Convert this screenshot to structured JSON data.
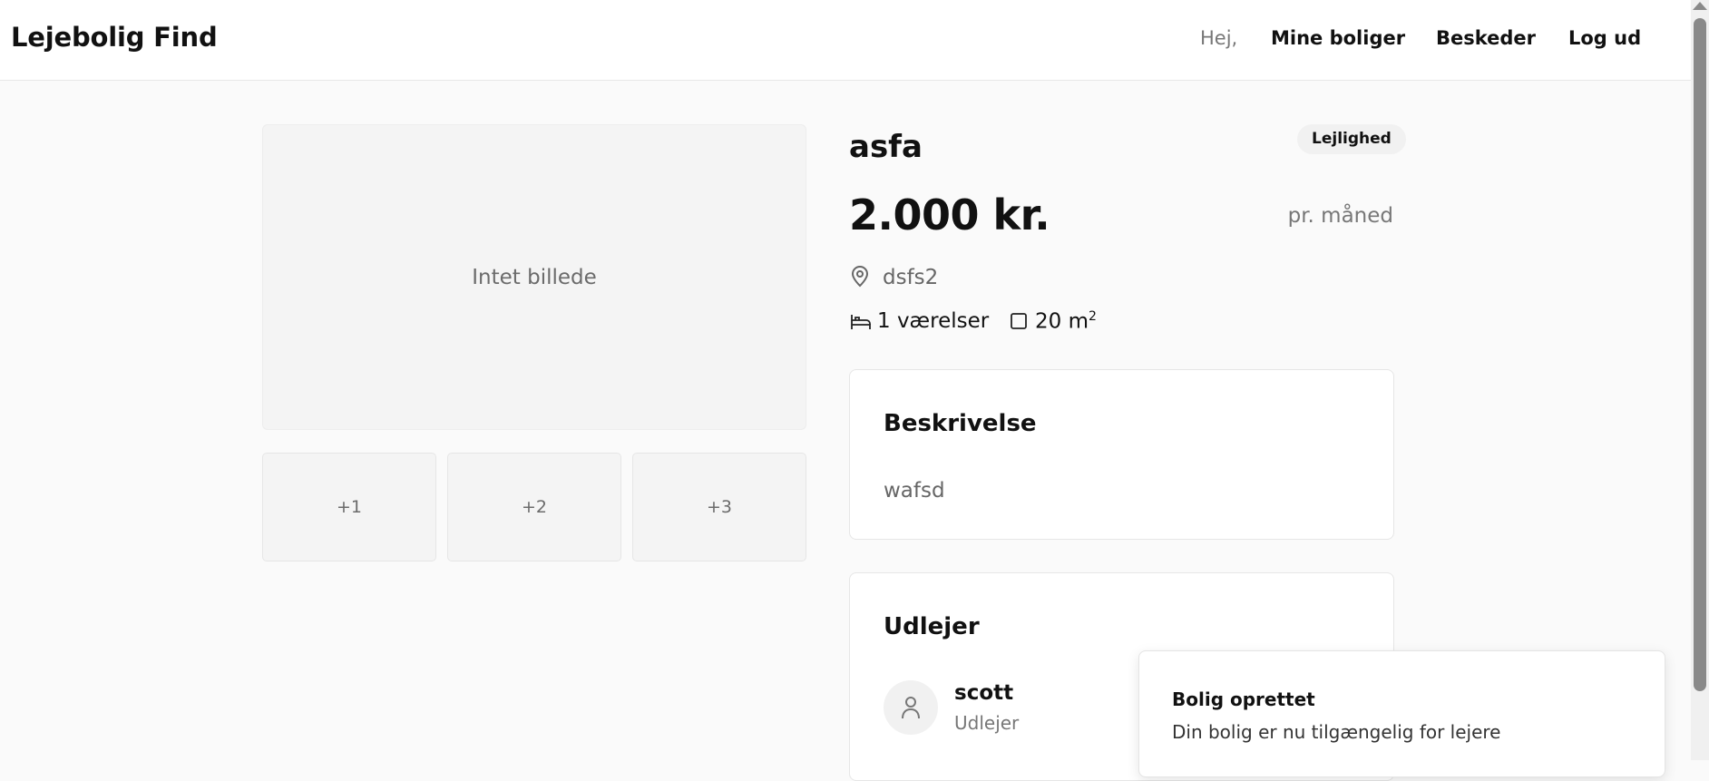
{
  "header": {
    "brand": "Lejebolig Find",
    "greeting": "Hej,",
    "nav": {
      "my_listings": "Mine boliger",
      "messages": "Beskeder",
      "logout": "Log ud"
    }
  },
  "gallery": {
    "main_placeholder": "Intet billede",
    "thumbnails": [
      "+1",
      "+2",
      "+3"
    ]
  },
  "listing": {
    "title": "asfa",
    "type_badge": "Lejlighed",
    "price": "2.000 kr.",
    "price_period": "pr. måned",
    "address": "dsfs2",
    "rooms": "1 værelser",
    "area_value": "20 m",
    "area_unit_sup": "2",
    "icons": {
      "address": "map-pin-icon",
      "rooms": "bed-icon",
      "area": "square-icon"
    }
  },
  "description": {
    "heading": "Beskrivelse",
    "text": "wafsd"
  },
  "owner": {
    "heading": "Udlejer",
    "name": "scott",
    "role": "Udlejer",
    "avatar_icon": "user-icon"
  },
  "toast": {
    "title": "Bolig oprettet",
    "text": "Din bolig er nu tilgængelig for lejere"
  }
}
